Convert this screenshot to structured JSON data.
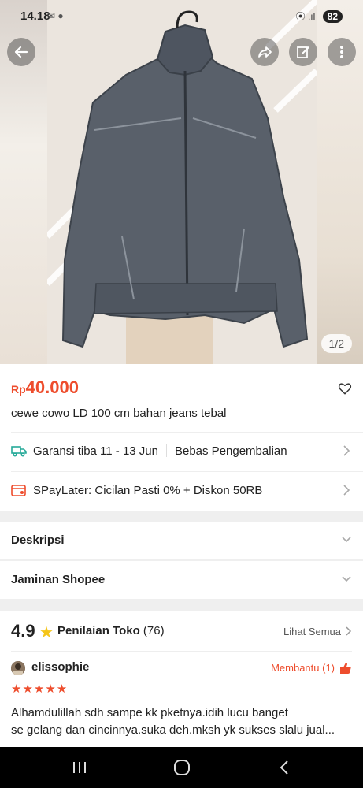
{
  "status_bar": {
    "time": "14.18",
    "icons": "✉ ●",
    "signal": "⦿ .ıl",
    "battery": "82"
  },
  "header": {
    "back_icon": "arrow-left-icon",
    "share_icon": "share-icon",
    "edit_icon": "edit-icon",
    "more_icon": "more-vertical-icon"
  },
  "gallery": {
    "page": "1/2"
  },
  "product": {
    "currency": "Rp",
    "price": "40.000",
    "title": "cewe cowo LD 100 cm bahan jeans tebal",
    "shipping_guarantee": "Garansi tiba 11 - 13 Jun",
    "return_policy": "Bebas Pengembalian",
    "paylater": "SPayLater: Cicilan Pasti 0% + Diskon 50RB"
  },
  "sections": {
    "description": "Deskripsi",
    "guarantee": "Jaminan Shopee"
  },
  "reviews": {
    "rating": "4.9",
    "label": "Penilaian Toko",
    "count": "(76)",
    "see_all": "Lihat Semua",
    "items": [
      {
        "username": "elissophie",
        "helpful": "Membantu (1)",
        "stars": "★★★★★",
        "line1": "Alhamdulillah sdh sampe kk pketnya.idih lucu banget",
        "line2": "se gelang dan cincinnya.suka deh.mksh yk sukses slalu jual..."
      }
    ]
  },
  "colors": {
    "accent": "#ee4d2d",
    "star": "#f5c518",
    "shipping": "#26aa99"
  }
}
